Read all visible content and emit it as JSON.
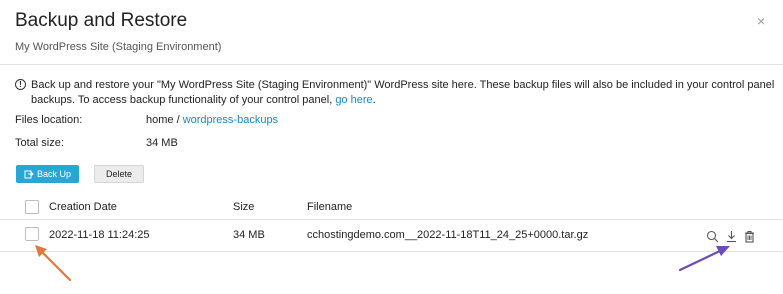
{
  "dialog": {
    "title": "Backup and Restore",
    "subtitle": "My WordPress Site (Staging Environment)",
    "close_glyph": "×"
  },
  "info": {
    "icon_glyph": "!",
    "text": "Back up and restore your \"My WordPress Site (Staging Environment)\" WordPress site here. These backup files will also be included in your control panel backups. To access backup functionality of your control panel, ",
    "link": "go here",
    "suffix": "."
  },
  "files": {
    "location_label": "Files location:",
    "location_prefix": "home / ",
    "location_link": "wordpress-backups",
    "size_label": "Total size:",
    "size_value": "34 MB"
  },
  "toolbar": {
    "backup_label": "Back Up",
    "delete_label": "Delete"
  },
  "table": {
    "headers": [
      "Creation Date",
      "Size",
      "Filename"
    ],
    "rows": [
      {
        "date": "2022-11-18 11:24:25",
        "size": "34 MB",
        "filename": "cchostingdemo.com__2022-11-18T11_24_25+0000.tar.gz"
      }
    ]
  },
  "colors": {
    "accent": "#28a7d6",
    "link": "#1e86c7",
    "arrow_orange": "#e07a3f",
    "arrow_purple": "#6a4bb8"
  },
  "icons": {
    "backup": "backup-icon",
    "search": "search-icon",
    "download": "download-icon",
    "delete": "trash-icon"
  }
}
